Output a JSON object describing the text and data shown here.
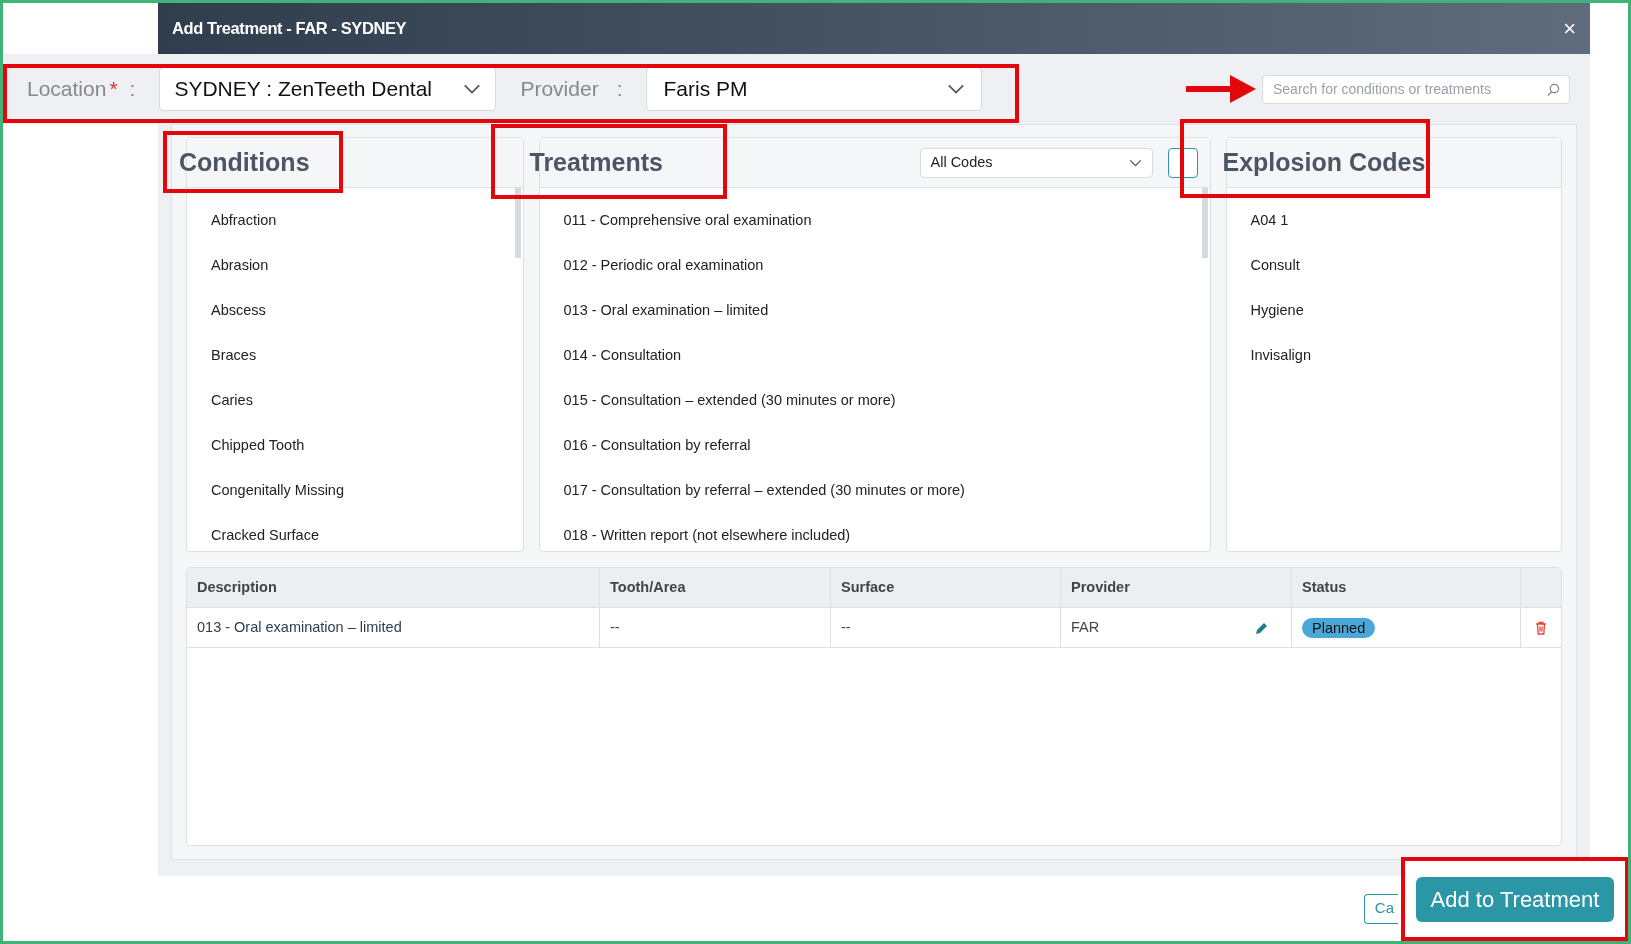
{
  "dialog": {
    "title": "Add Treatment - FAR - SYDNEY",
    "close": "×"
  },
  "location": {
    "label": "Location",
    "required_mark": "*",
    "separator": ":",
    "value": "SYDNEY : ZenTeeth Dental"
  },
  "provider": {
    "label": "Provider",
    "separator": ":",
    "value": "Faris PM"
  },
  "search": {
    "placeholder": "Search for conditions or treatments"
  },
  "conditions": {
    "title": "Conditions",
    "items": [
      "Abfraction",
      "Abrasion",
      "Abscess",
      "Braces",
      "Caries",
      "Chipped Tooth",
      "Congenitally Missing",
      "Cracked Surface"
    ]
  },
  "treatments": {
    "title": "Treatments",
    "filter": "All Codes",
    "items": [
      "011 - Comprehensive oral examination",
      "012 - Periodic oral examination",
      "013 - Oral examination – limited",
      "014 - Consultation",
      "015 - Consultation – extended (30 minutes or more)",
      "016 - Consultation by referral",
      "017 - Consultation by referral – extended (30 minutes or more)",
      "018 - Written report (not elsewhere included)"
    ]
  },
  "explosion_codes": {
    "title": "Explosion Codes",
    "items": [
      "A04 1",
      "Consult",
      "Hygiene",
      "Invisalign"
    ]
  },
  "table": {
    "columns": [
      "Description",
      "Tooth/Area",
      "Surface",
      "Provider",
      "Status"
    ],
    "rows": [
      {
        "description": "013 - Oral examination – limited",
        "tooth_area": "--",
        "surface": "--",
        "provider": "FAR",
        "status": "Planned"
      }
    ]
  },
  "buttons": {
    "cancel": "Ca",
    "add": "Add to Treatment"
  }
}
